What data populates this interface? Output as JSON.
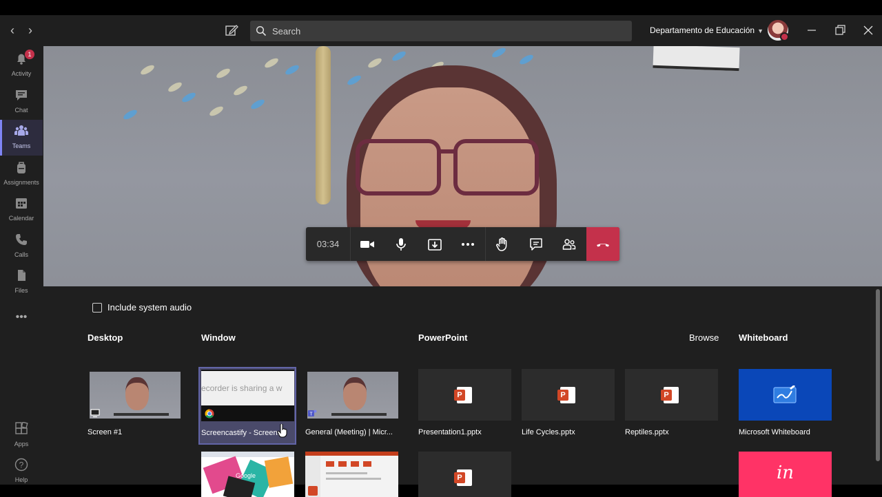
{
  "titlebar": {
    "search_placeholder": "Search",
    "org_name": "Departamento de Educación"
  },
  "rail": {
    "items": [
      {
        "label": "Activity",
        "icon": "bell-icon",
        "badge": "1"
      },
      {
        "label": "Chat",
        "icon": "chat-icon"
      },
      {
        "label": "Teams",
        "icon": "teams-icon",
        "active": true
      },
      {
        "label": "Assignments",
        "icon": "backpack-icon"
      },
      {
        "label": "Calendar",
        "icon": "calendar-icon"
      },
      {
        "label": "Calls",
        "icon": "phone-icon"
      },
      {
        "label": "Files",
        "icon": "file-icon"
      }
    ],
    "more": "•••",
    "bottom": [
      {
        "label": "Apps",
        "icon": "apps-icon"
      },
      {
        "label": "Help",
        "icon": "help-icon"
      }
    ]
  },
  "call": {
    "timer": "03:34",
    "accent_hangup": "#c4314b"
  },
  "share": {
    "include_audio": "Include system audio",
    "sections": {
      "desktop": "Desktop",
      "window": "Window",
      "powerpoint": "PowerPoint",
      "browse": "Browse",
      "whiteboard": "Whiteboard"
    },
    "desktop_tiles": [
      {
        "caption": "Screen #1"
      }
    ],
    "window_tiles": [
      {
        "caption": "Screencastify - Screen...",
        "thumb_text": "ecorder is sharing a w",
        "selected": true
      },
      {
        "caption": "General (Meeting) | Micr..."
      }
    ],
    "ppt_tiles": [
      {
        "caption": "Presentation1.pptx"
      },
      {
        "caption": "Life Cycles.pptx"
      },
      {
        "caption": "Reptiles.pptx"
      }
    ],
    "whiteboard_tiles": [
      {
        "caption": "Microsoft Whiteboard"
      }
    ],
    "whiteboard_second_logo": "in",
    "google_label": "Google"
  }
}
